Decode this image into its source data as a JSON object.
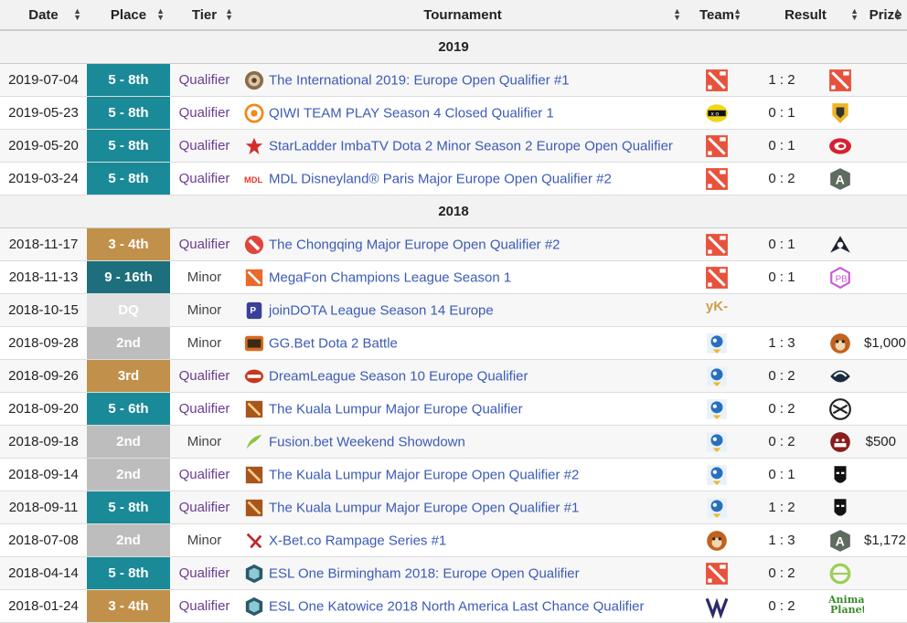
{
  "colors": {
    "gold": "#c1914b",
    "teal": "#1b8a98",
    "darkteal": "#1e6f7d",
    "silver": "#bdbdbd",
    "dq": "#e0e0e0"
  },
  "headers": {
    "date": "Date",
    "place": "Place",
    "tier": "Tier",
    "tournament": "Tournament",
    "team": "Team",
    "result": "Result",
    "prize": "Prize"
  },
  "sort_icon": "⬍",
  "years": [
    {
      "year": "2019",
      "rows": [
        {
          "date": "2019-07-04",
          "place": "5 - 8th",
          "place_color": "teal",
          "tier": "Qualifier",
          "tier_link": true,
          "tournament": "The International 2019: Europe Open Qualifier #1",
          "t_icon": "aegis-icon",
          "team": "dota-icon",
          "result": "1 : 2",
          "opp": "dota-icon",
          "prize": ""
        },
        {
          "date": "2019-05-23",
          "place": "5 - 8th",
          "place_color": "teal",
          "tier": "Qualifier",
          "tier_link": true,
          "tournament": "QIWI TEAM PLAY Season 4 Closed Qualifier 1",
          "t_icon": "qiwi-icon",
          "team": "xo-icon",
          "result": "0 : 1",
          "opp": "shield-yellow-icon",
          "prize": ""
        },
        {
          "date": "2019-05-20",
          "place": "5 - 8th",
          "place_color": "teal",
          "tier": "Qualifier",
          "tier_link": true,
          "tournament": "StarLadder ImbaTV Dota 2 Minor Season 2 Europe Open Qualifier",
          "t_icon": "star-icon",
          "team": "dota-icon",
          "result": "0 : 1",
          "opp": "red-swirl-icon",
          "prize": ""
        },
        {
          "date": "2019-03-24",
          "place": "5 - 8th",
          "place_color": "teal",
          "tier": "Qualifier",
          "tier_link": true,
          "tournament": "MDL Disneyland® Paris Major Europe Open Qualifier #2",
          "t_icon": "mdl-icon",
          "team": "dota-icon",
          "result": "0 : 2",
          "opp": "alliance-icon",
          "prize": ""
        }
      ]
    },
    {
      "year": "2018",
      "rows": [
        {
          "date": "2018-11-17",
          "place": "3 - 4th",
          "place_color": "gold",
          "tier": "Qualifier",
          "tier_link": true,
          "tournament": "The Chongqing Major Europe Open Qualifier #2",
          "t_icon": "dota-round-icon",
          "team": "dota-icon",
          "result": "0 : 1",
          "opp": "dark-wings-icon",
          "prize": ""
        },
        {
          "date": "2018-11-13",
          "place": "9 - 16th",
          "place_color": "darkteal",
          "tier": "Minor",
          "tier_link": false,
          "tournament": "MegaFon Champions League Season 1",
          "t_icon": "dota-small-icon",
          "team": "dota-icon",
          "result": "0 : 1",
          "opp": "hex-pink-icon",
          "prize": ""
        },
        {
          "date": "2018-10-15",
          "place": "DQ",
          "place_color": "dq",
          "tier": "Minor",
          "tier_link": false,
          "tournament": "joinDOTA League Season 14 Europe",
          "t_icon": "jdl-icon",
          "team": "yk-icon",
          "result": "",
          "opp": "",
          "prize": ""
        },
        {
          "date": "2018-09-28",
          "place": "2nd",
          "place_color": "silver",
          "tier": "Minor",
          "tier_link": false,
          "tournament": "GG.Bet Dota 2 Battle",
          "t_icon": "ggbet-icon",
          "team": "duck-icon",
          "result": "1 : 3",
          "opp": "monkey-icon",
          "prize": "$1,000"
        },
        {
          "date": "2018-09-26",
          "place": "3rd",
          "place_color": "gold",
          "tier": "Qualifier",
          "tier_link": true,
          "tournament": "DreamLeague Season 10 Europe Qualifier",
          "t_icon": "dreamleague-icon",
          "team": "duck-icon",
          "result": "0 : 2",
          "opp": "liquid-icon",
          "prize": ""
        },
        {
          "date": "2018-09-20",
          "place": "5 - 6th",
          "place_color": "teal",
          "tier": "Qualifier",
          "tier_link": true,
          "tournament": "The Kuala Lumpur Major Europe Qualifier",
          "t_icon": "dota-square-icon",
          "team": "duck-icon",
          "result": "0 : 2",
          "opp": "nip-icon",
          "prize": ""
        },
        {
          "date": "2018-09-18",
          "place": "2nd",
          "place_color": "silver",
          "tier": "Minor",
          "tier_link": false,
          "tournament": "Fusion.bet Weekend Showdown",
          "t_icon": "leaf-icon",
          "team": "duck-icon",
          "result": "0 : 2",
          "opp": "bulldog-icon",
          "prize": "$500"
        },
        {
          "date": "2018-09-14",
          "place": "2nd",
          "place_color": "silver",
          "tier": "Qualifier",
          "tier_link": true,
          "tournament": "The Kuala Lumpur Major Europe Open Qualifier #2",
          "t_icon": "dota-square-icon",
          "team": "duck-icon",
          "result": "0 : 1",
          "opp": "mask-icon",
          "prize": ""
        },
        {
          "date": "2018-09-11",
          "place": "5 - 8th",
          "place_color": "teal",
          "tier": "Qualifier",
          "tier_link": true,
          "tournament": "The Kuala Lumpur Major Europe Open Qualifier #1",
          "t_icon": "dota-square-icon",
          "team": "duck-icon",
          "result": "1 : 2",
          "opp": "mask-icon",
          "prize": ""
        },
        {
          "date": "2018-07-08",
          "place": "2nd",
          "place_color": "silver",
          "tier": "Minor",
          "tier_link": false,
          "tournament": "X-Bet.co Rampage Series #1",
          "t_icon": "xbet-icon",
          "team": "monkey-icon",
          "result": "1 : 3",
          "opp": "alliance-icon",
          "prize": "$1,172"
        },
        {
          "date": "2018-04-14",
          "place": "5 - 8th",
          "place_color": "teal",
          "tier": "Qualifier",
          "tier_link": true,
          "tournament": "ESL One Birmingham 2018: Europe Open Qualifier",
          "t_icon": "esl-icon",
          "team": "dota-icon",
          "result": "0 : 2",
          "opp": "optic-icon",
          "prize": ""
        },
        {
          "date": "2018-01-24",
          "place": "3 - 4th",
          "place_color": "gold",
          "tier": "Qualifier",
          "tier_link": true,
          "tournament": "ESL One Katowice 2018 North America Last Chance Qualifier",
          "t_icon": "esl-icon",
          "team": "vgj-icon",
          "result": "0 : 2",
          "opp": "animal-planet-icon",
          "prize": ""
        }
      ]
    }
  ],
  "logo_text": {
    "yk": "yK-",
    "animal_planet_1": "Animal",
    "animal_planet_2": "Planet",
    "xo": "x o",
    "mdl": "MDL"
  }
}
